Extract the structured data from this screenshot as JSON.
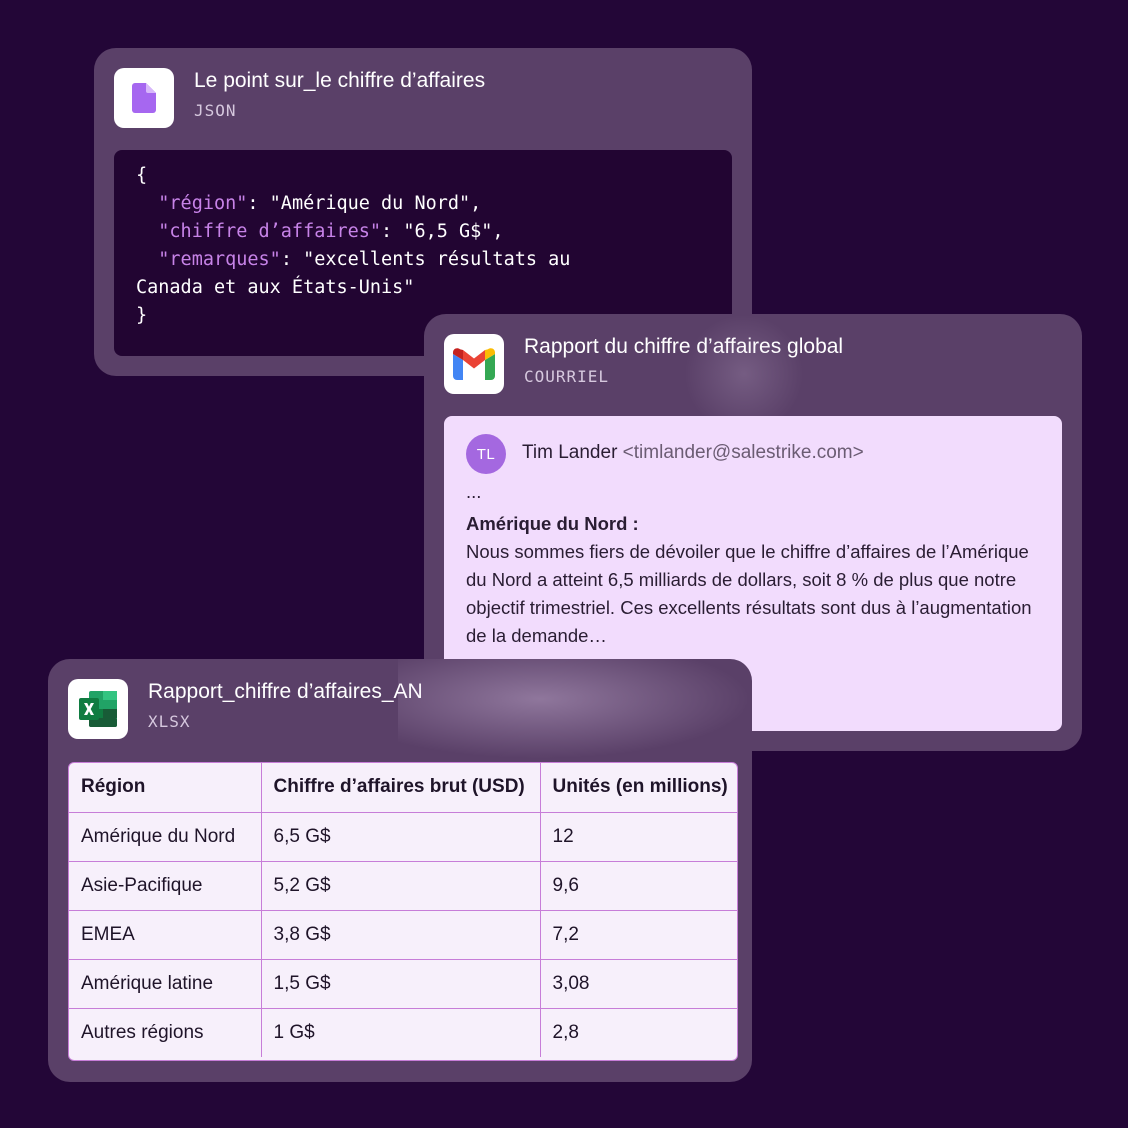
{
  "json_card": {
    "title": "Le point sur_le chiffre d’affaires",
    "subtitle": "JSON",
    "icon": "file-icon",
    "code": {
      "open": "{",
      "lines": [
        {
          "key": "\"région\"",
          "rest": ": \"Amérique du Nord\","
        },
        {
          "key": "\"chiffre d’affaires\"",
          "rest": ": \"6,5 G$\","
        },
        {
          "key": "\"remarques\"",
          "rest": ": \"excellents résultats au"
        }
      ],
      "wrap": "Canada et aux États-Unis\"",
      "close": "}"
    }
  },
  "email_card": {
    "title": "Rapport du chiffre d’affaires global",
    "subtitle": "COURRIEL",
    "icon": "gmail-icon",
    "avatar_initials": "TL",
    "sender_name": "Tim Lander",
    "sender_email": "<timlander@salestrike.com>",
    "ellipsis": "...",
    "heading": "Amérique du Nord :",
    "body": "Nous sommes fiers de dévoiler que le chiffre d’affaires de l’Amérique du Nord a atteint 6,5 milliards de dollars, soit 8 % de plus que notre objectif trimestriel. Ces excellents résultats sont dus à l’augmentation de la demande…"
  },
  "xlsx_card": {
    "title": "Rapport_chiffre d’affaires_AN",
    "subtitle": "XLSX",
    "icon": "excel-icon",
    "headers": [
      "Région",
      "Chiffre d’affaires brut (USD)",
      "Unités (en millions)"
    ],
    "rows": [
      [
        "Amérique du Nord",
        "6,5 G$",
        "12"
      ],
      [
        "Asie-Pacifique",
        "5,2 G$",
        "9,6"
      ],
      [
        "EMEA",
        "3,8 G$",
        "7,2"
      ],
      [
        "Amérique latine",
        "1,5 G$",
        "3,08"
      ],
      [
        "Autres régions",
        "1 G$",
        "2,8"
      ]
    ]
  },
  "colors": {
    "background": "#230637",
    "card": "#5a4068",
    "code_bg": "#220532",
    "code_key": "#c783e8",
    "email_body_bg": "#f2dcfd",
    "avatar": "#a468e0",
    "table_border": "#c77dd8"
  }
}
